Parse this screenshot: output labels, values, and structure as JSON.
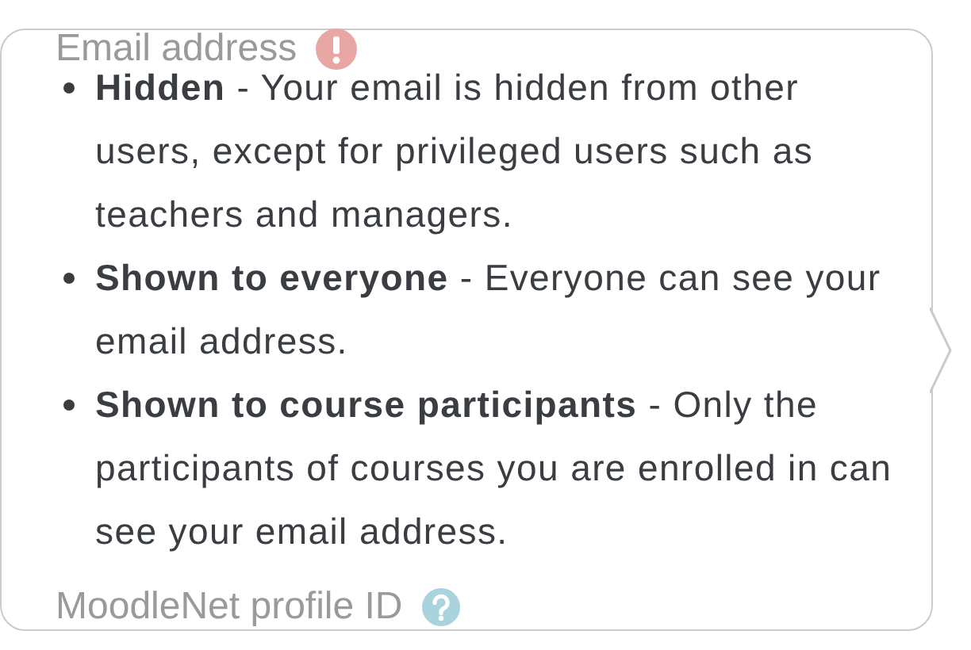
{
  "form": {
    "fields": [
      {
        "kind": "required",
        "label": "Email address"
      },
      {
        "kind": "help",
        "label": "MoodleNet profile ID"
      }
    ]
  },
  "popover": {
    "items": [
      "**Hidden** - Your email is hidden from other users, except for privileged users such as teachers and managers.",
      "**Shown to everyone** - Everyone can see your email address.",
      "**Shown to course participants** - Only the participants of courses you are enrolled in can see your email address."
    ]
  }
}
